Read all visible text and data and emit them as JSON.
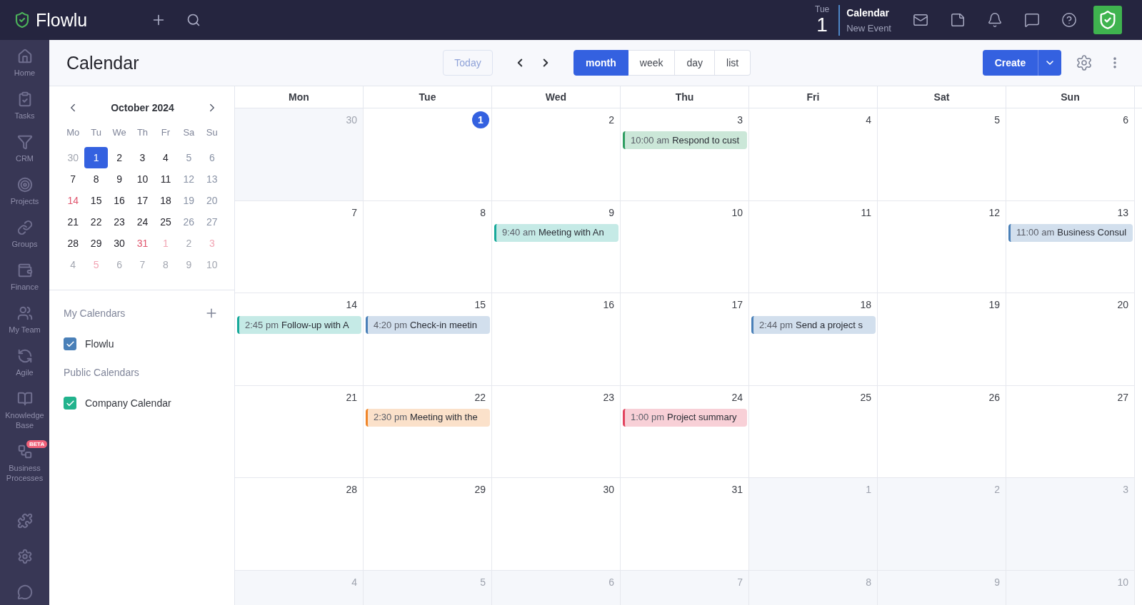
{
  "topbar": {
    "logo": "Flowlu",
    "date": {
      "weekday": "Tue",
      "day": "1"
    },
    "recent": {
      "title": "Calendar",
      "subtitle": "New Event"
    }
  },
  "sidebar": {
    "items": [
      {
        "label": "Home"
      },
      {
        "label": "Tasks"
      },
      {
        "label": "CRM"
      },
      {
        "label": "Projects"
      },
      {
        "label": "Groups"
      },
      {
        "label": "Finance"
      },
      {
        "label": "My Team"
      },
      {
        "label": "Agile"
      },
      {
        "label": "Knowledge Base"
      },
      {
        "label": "Business Processes",
        "badge": "BETA"
      }
    ]
  },
  "header": {
    "title": "Calendar",
    "today": {
      "label": "Today",
      "disabled": true
    },
    "views": [
      {
        "label": "month",
        "selected": true
      },
      {
        "label": "week",
        "selected": false
      },
      {
        "label": "day",
        "selected": false
      },
      {
        "label": "list",
        "selected": false
      }
    ],
    "create": "Create"
  },
  "mini_calendar": {
    "title": "October 2024",
    "weekdays": [
      "Mo",
      "Tu",
      "We",
      "Th",
      "Fr",
      "Sa",
      "Su"
    ],
    "weeks": [
      [
        {
          "label": "30",
          "selected": false,
          "outside": true,
          "holiday": false
        },
        {
          "label": "1",
          "selected": true,
          "outside": false,
          "holiday": false
        },
        {
          "label": "2",
          "selected": false,
          "outside": false,
          "holiday": false
        },
        {
          "label": "3",
          "selected": false,
          "outside": false,
          "holiday": false
        },
        {
          "label": "4",
          "selected": false,
          "outside": false,
          "holiday": false
        },
        {
          "label": "5",
          "selected": false,
          "outside": false,
          "holiday": false
        },
        {
          "label": "6",
          "selected": false,
          "outside": false,
          "holiday": false
        }
      ],
      [
        {
          "label": "7",
          "selected": false,
          "outside": false,
          "holiday": false
        },
        {
          "label": "8",
          "selected": false,
          "outside": false,
          "holiday": false
        },
        {
          "label": "9",
          "selected": false,
          "outside": false,
          "holiday": false
        },
        {
          "label": "10",
          "selected": false,
          "outside": false,
          "holiday": false
        },
        {
          "label": "11",
          "selected": false,
          "outside": false,
          "holiday": false
        },
        {
          "label": "12",
          "selected": false,
          "outside": false,
          "holiday": false
        },
        {
          "label": "13",
          "selected": false,
          "outside": false,
          "holiday": false
        }
      ],
      [
        {
          "label": "14",
          "selected": false,
          "outside": false,
          "holiday": true
        },
        {
          "label": "15",
          "selected": false,
          "outside": false,
          "holiday": false
        },
        {
          "label": "16",
          "selected": false,
          "outside": false,
          "holiday": false
        },
        {
          "label": "17",
          "selected": false,
          "outside": false,
          "holiday": false
        },
        {
          "label": "18",
          "selected": false,
          "outside": false,
          "holiday": false
        },
        {
          "label": "19",
          "selected": false,
          "outside": false,
          "holiday": false
        },
        {
          "label": "20",
          "selected": false,
          "outside": false,
          "holiday": false
        }
      ],
      [
        {
          "label": "21",
          "selected": false,
          "outside": false,
          "holiday": false
        },
        {
          "label": "22",
          "selected": false,
          "outside": false,
          "holiday": false
        },
        {
          "label": "23",
          "selected": false,
          "outside": false,
          "holiday": false
        },
        {
          "label": "24",
          "selected": false,
          "outside": false,
          "holiday": false
        },
        {
          "label": "25",
          "selected": false,
          "outside": false,
          "holiday": false
        },
        {
          "label": "26",
          "selected": false,
          "outside": false,
          "holiday": false
        },
        {
          "label": "27",
          "selected": false,
          "outside": false,
          "holiday": false
        }
      ],
      [
        {
          "label": "28",
          "selected": false,
          "outside": false,
          "holiday": false
        },
        {
          "label": "29",
          "selected": false,
          "outside": false,
          "holiday": false
        },
        {
          "label": "30",
          "selected": false,
          "outside": false,
          "holiday": false
        },
        {
          "label": "31",
          "selected": false,
          "outside": false,
          "holiday": true
        },
        {
          "label": "1",
          "selected": false,
          "outside": true,
          "holiday": true
        },
        {
          "label": "2",
          "selected": false,
          "outside": true,
          "holiday": false
        },
        {
          "label": "3",
          "selected": false,
          "outside": true,
          "holiday": true
        }
      ],
      [
        {
          "label": "4",
          "selected": false,
          "outside": true,
          "holiday": false
        },
        {
          "label": "5",
          "selected": false,
          "outside": true,
          "holiday": true
        },
        {
          "label": "6",
          "selected": false,
          "outside": true,
          "holiday": false
        },
        {
          "label": "7",
          "selected": false,
          "outside": true,
          "holiday": false
        },
        {
          "label": "8",
          "selected": false,
          "outside": true,
          "holiday": false
        },
        {
          "label": "9",
          "selected": false,
          "outside": true,
          "holiday": false
        },
        {
          "label": "10",
          "selected": false,
          "outside": true,
          "holiday": false
        }
      ]
    ]
  },
  "calendars": {
    "my": {
      "title": "My Calendars",
      "items": [
        {
          "label": "Flowlu",
          "checked": true,
          "color": "#4a80b8"
        }
      ]
    },
    "public": {
      "title": "Public Calendars",
      "items": [
        {
          "label": "Company Calendar",
          "checked": true,
          "color": "#22b38d"
        }
      ]
    }
  },
  "grid": {
    "weekdays": [
      "Mon",
      "Tue",
      "Wed",
      "Thu",
      "Fri",
      "Sat",
      "Sun"
    ],
    "weeks": [
      [
        {
          "label": "30",
          "outside": true,
          "today": false
        },
        {
          "label": "1",
          "outside": false,
          "today": true
        },
        {
          "label": "2",
          "outside": false,
          "today": false
        },
        {
          "label": "3",
          "outside": false,
          "today": false,
          "events": [
            {
              "time": "10:00 am",
              "title": "Respond to cust",
              "color": "#2f9e62"
            }
          ]
        },
        {
          "label": "4",
          "outside": false,
          "today": false
        },
        {
          "label": "5",
          "outside": false,
          "today": false
        },
        {
          "label": "6",
          "outside": false,
          "today": false
        }
      ],
      [
        {
          "label": "7",
          "outside": false,
          "today": false
        },
        {
          "label": "8",
          "outside": false,
          "today": false
        },
        {
          "label": "9",
          "outside": false,
          "today": false,
          "events": [
            {
              "time": "9:40 am",
              "title": "Meeting with An",
              "color": "#17a99a"
            }
          ]
        },
        {
          "label": "10",
          "outside": false,
          "today": false
        },
        {
          "label": "11",
          "outside": false,
          "today": false
        },
        {
          "label": "12",
          "outside": false,
          "today": false
        },
        {
          "label": "13",
          "outside": false,
          "today": false,
          "events": [
            {
              "time": "11:00 am",
              "title": "Business Consul",
              "color": "#4a80b8"
            }
          ]
        }
      ],
      [
        {
          "label": "14",
          "outside": false,
          "today": false,
          "events": [
            {
              "time": "2:45 pm",
              "title": "Follow-up with A",
              "color": "#17a99a"
            }
          ]
        },
        {
          "label": "15",
          "outside": false,
          "today": false,
          "events": [
            {
              "time": "4:20 pm",
              "title": "Check-in meetin",
              "color": "#4a80b8"
            }
          ]
        },
        {
          "label": "16",
          "outside": false,
          "today": false
        },
        {
          "label": "17",
          "outside": false,
          "today": false
        },
        {
          "label": "18",
          "outside": false,
          "today": false,
          "events": [
            {
              "time": "2:44 pm",
              "title": "Send a project s",
              "color": "#4a80b8"
            }
          ]
        },
        {
          "label": "19",
          "outside": false,
          "today": false
        },
        {
          "label": "20",
          "outside": false,
          "today": false
        }
      ],
      [
        {
          "label": "21",
          "outside": false,
          "today": false
        },
        {
          "label": "22",
          "outside": false,
          "today": false,
          "events": [
            {
              "time": "2:30 pm",
              "title": "Meeting with the",
              "color": "#f0862a"
            }
          ]
        },
        {
          "label": "23",
          "outside": false,
          "today": false
        },
        {
          "label": "24",
          "outside": false,
          "today": false,
          "events": [
            {
              "time": "1:00 pm",
              "title": "Project summary",
              "color": "#e2445f"
            }
          ]
        },
        {
          "label": "25",
          "outside": false,
          "today": false
        },
        {
          "label": "26",
          "outside": false,
          "today": false
        },
        {
          "label": "27",
          "outside": false,
          "today": false
        }
      ],
      [
        {
          "label": "28",
          "outside": false,
          "today": false
        },
        {
          "label": "29",
          "outside": false,
          "today": false
        },
        {
          "label": "30",
          "outside": false,
          "today": false
        },
        {
          "label": "31",
          "outside": false,
          "today": false
        },
        {
          "label": "1",
          "outside": true,
          "today": false
        },
        {
          "label": "2",
          "outside": true,
          "today": false
        },
        {
          "label": "3",
          "outside": true,
          "today": false
        }
      ],
      [
        {
          "label": "4",
          "outside": true,
          "today": false
        },
        {
          "label": "5",
          "outside": true,
          "today": false
        },
        {
          "label": "6",
          "outside": true,
          "today": false
        },
        {
          "label": "7",
          "outside": true,
          "today": false
        },
        {
          "label": "8",
          "outside": true,
          "today": false
        },
        {
          "label": "9",
          "outside": true,
          "today": false
        },
        {
          "label": "10",
          "outside": true,
          "today": false
        }
      ]
    ]
  }
}
